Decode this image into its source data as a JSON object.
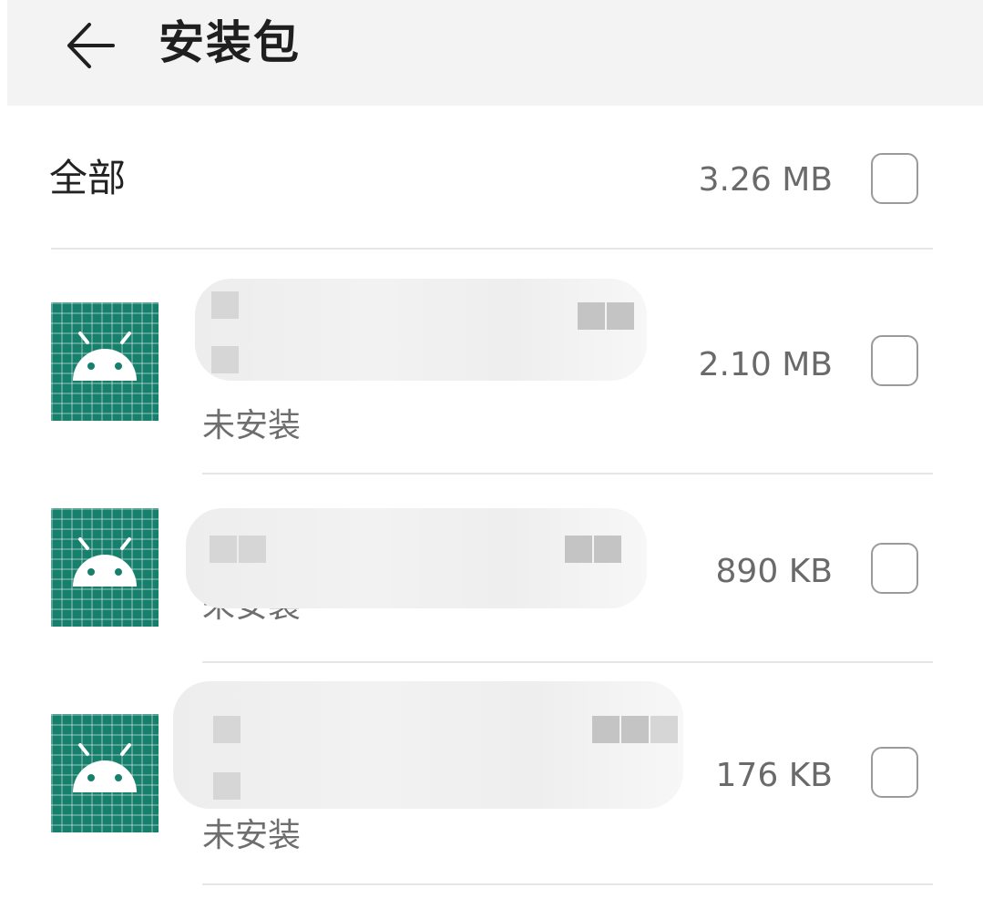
{
  "appbar": {
    "title": "安装包",
    "back_icon": "arrow-left-icon"
  },
  "select_all": {
    "label": "全部",
    "size": "3.26 MB",
    "checked": false
  },
  "packages": [
    {
      "icon": "android-icon",
      "name_obscured": true,
      "status": "未安装",
      "size": "2.10 MB",
      "checked": false
    },
    {
      "icon": "android-icon",
      "name_obscured": true,
      "status": "未安装",
      "size": "890 KB",
      "checked": false
    },
    {
      "icon": "android-icon",
      "name_obscured": true,
      "status": "未安装",
      "size": "176 KB",
      "checked": false
    }
  ],
  "colors": {
    "appbar_bg": "#f3f3f3",
    "icon_bg": "#17806c",
    "divider": "#e6e6e6",
    "checkbox_border": "#9a9a9a"
  }
}
